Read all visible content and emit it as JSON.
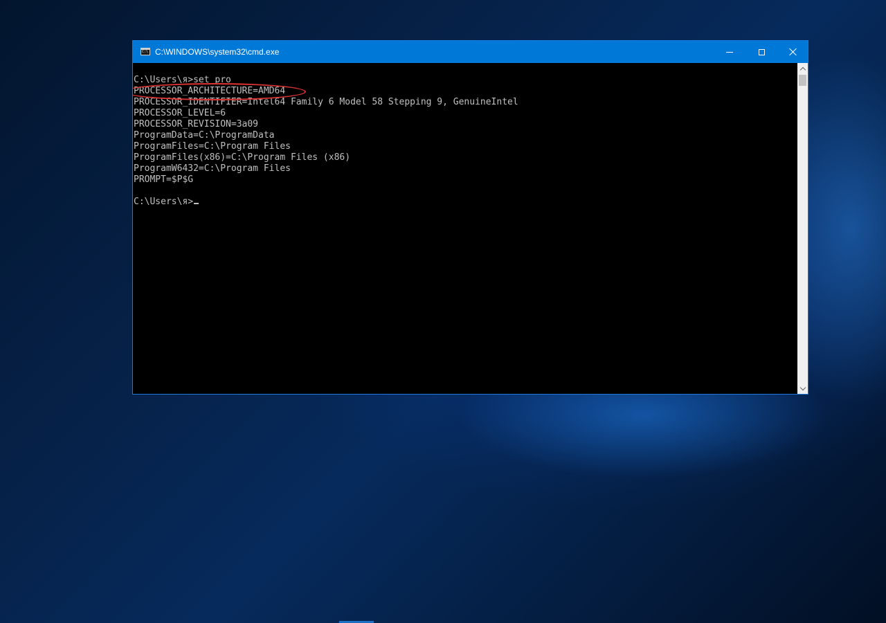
{
  "window": {
    "title": "C:\\WINDOWS\\system32\\cmd.exe",
    "icon": "cmd-icon",
    "accent_color": "#0078d7"
  },
  "controls": {
    "minimize_icon": "minimize-icon",
    "maximize_icon": "maximize-icon",
    "close_icon": "close-icon"
  },
  "console": {
    "background_color": "#000000",
    "text_color": "#c0c0c0",
    "lines": [
      "C:\\Users\\я>set pro",
      "PROCESSOR_ARCHITECTURE=AMD64",
      "PROCESSOR_IDENTIFIER=Intel64 Family 6 Model 58 Stepping 9, GenuineIntel",
      "PROCESSOR_LEVEL=6",
      "PROCESSOR_REVISION=3a09",
      "ProgramData=C:\\ProgramData",
      "ProgramFiles=C:\\Program Files",
      "ProgramFiles(x86)=C:\\Program Files (x86)",
      "ProgramW6432=C:\\Program Files",
      "PROMPT=$P$G",
      "",
      "C:\\Users\\я>"
    ],
    "highlight_color": "#e03333"
  },
  "scrollbar": {
    "up_icon": "chevron-up-icon",
    "down_icon": "chevron-down-icon"
  }
}
